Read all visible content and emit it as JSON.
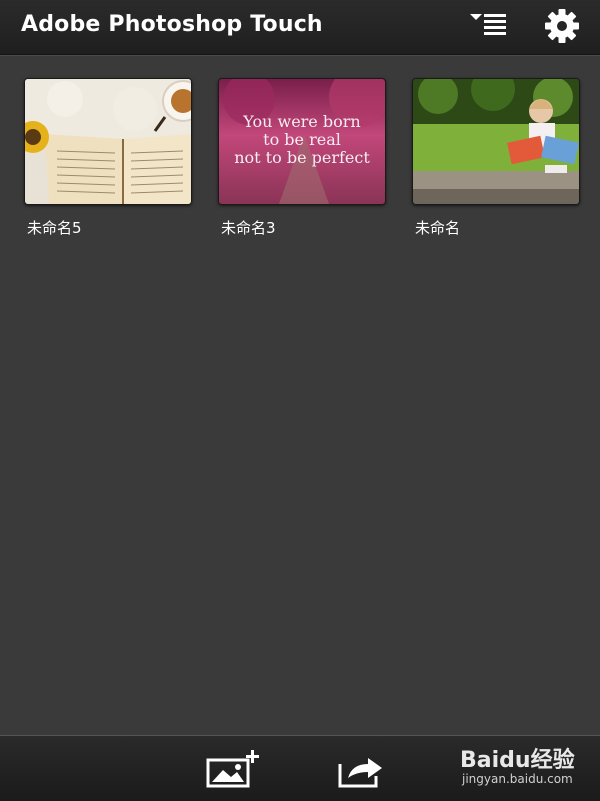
{
  "app": {
    "title": "Adobe Photoshop Touch"
  },
  "toolbar": {
    "sort_icon": "sort-list-icon",
    "settings_icon": "gear-icon"
  },
  "projects": [
    {
      "label": "未命名5",
      "thumbnail": "book-sunflower-teacup-photo"
    },
    {
      "label": "未命名3",
      "thumbnail": "pink-trees-quote-photo",
      "overlay_lines": [
        "You were born",
        "to be real",
        "not to be perfect"
      ]
    },
    {
      "label": "未命名",
      "thumbnail": "girl-reading-on-bench-photo"
    }
  ],
  "bottom_bar": {
    "add_image_icon": "add-image-icon",
    "share_icon": "share-icon"
  },
  "watermark": {
    "brand": "Baidu经验",
    "url": "jingyan.baidu.com"
  },
  "colors": {
    "background": "#3a3a3a",
    "bar": "#1f1f1f",
    "text": "#ffffff"
  }
}
